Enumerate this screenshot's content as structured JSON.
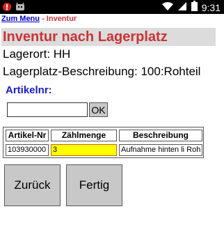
{
  "status_bar": {
    "time": "9:31",
    "icons": [
      "alert-icon",
      "android-icon",
      "wifi-icon",
      "signal-icon",
      "battery-icon"
    ]
  },
  "breadcrumb": {
    "menu_link": "Zum Menu",
    "separator": "-",
    "current": "Inventur"
  },
  "page": {
    "title": "Inventur nach Lagerplatz",
    "lagerort": "Lagerort: HH",
    "lagerplatz": "Lagerplatz-Beschreibung: 100:Rohteil"
  },
  "search": {
    "label": "Artikelnr:",
    "value": "",
    "ok_label": "OK"
  },
  "table": {
    "columns": [
      "Artikel-Nr",
      "Zählmenge",
      "Beschreibung"
    ],
    "rows": [
      {
        "artikel_nr": "103930000",
        "zaehlmenge": "3",
        "beschreibung": "Aufnahme hinten li Roh"
      }
    ]
  },
  "buttons": {
    "back": "Zurück",
    "done": "Fertig"
  },
  "colors": {
    "title": "#cc3333",
    "label": "#1a1acc",
    "highlight": "#ffff00",
    "link": "#0000cc"
  }
}
